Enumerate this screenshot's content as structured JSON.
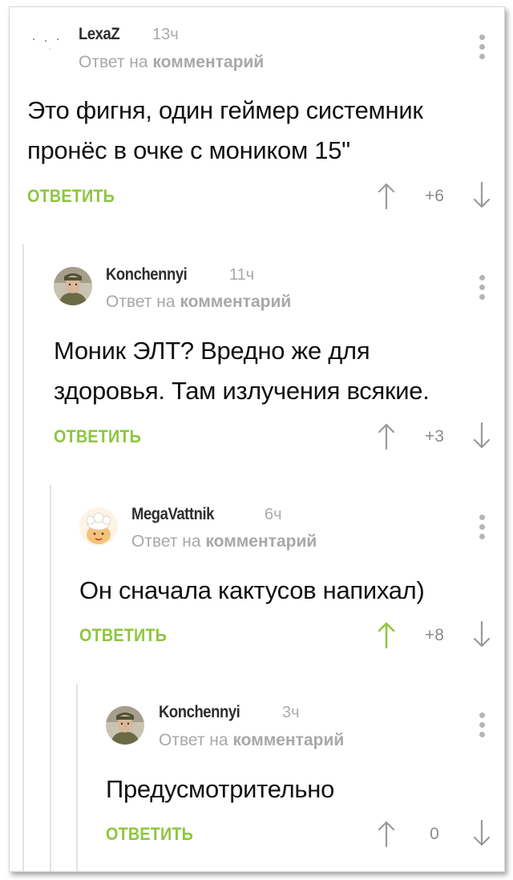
{
  "reply_to": {
    "prefix": "Ответ на",
    "target": "комментарий"
  },
  "comments": [
    {
      "author": "LexaZ",
      "time": "13ч",
      "text": [
        "Это фигня, один геймер системник",
        "пронёс в очке с моником 15\""
      ],
      "reply_label": "ОТВЕТИТЬ",
      "rating": "+6",
      "voted_up": false
    },
    {
      "author": "Konchennyi",
      "time": "11ч",
      "text": [
        "Моник ЭЛТ? Вредно же для",
        "здоровья. Там излучения всякие."
      ],
      "reply_label": "ОТВЕТИТЬ",
      "rating": "+3",
      "voted_up": false
    },
    {
      "author": "MegaVattnik",
      "time": "6ч",
      "text": [
        "Он сначала кактусов напихал)"
      ],
      "reply_label": "ОТВЕТИТЬ",
      "rating": "+8",
      "voted_up": true
    },
    {
      "author": "Konchennyi",
      "time": "3ч",
      "text": [
        "Предусмотрительно"
      ],
      "reply_label": "ОТВЕТИТЬ",
      "rating": "0",
      "voted_up": false
    }
  ],
  "colors": {
    "accent_green": "#8dc63f",
    "muted_text": "#a8a8a8",
    "icon_gray": "#9a9a9a",
    "thread_line": "#e3e3e3"
  },
  "icons": {
    "up": "arrow-up-icon",
    "down": "arrow-down-icon",
    "menu": "kebab-menu-icon"
  }
}
